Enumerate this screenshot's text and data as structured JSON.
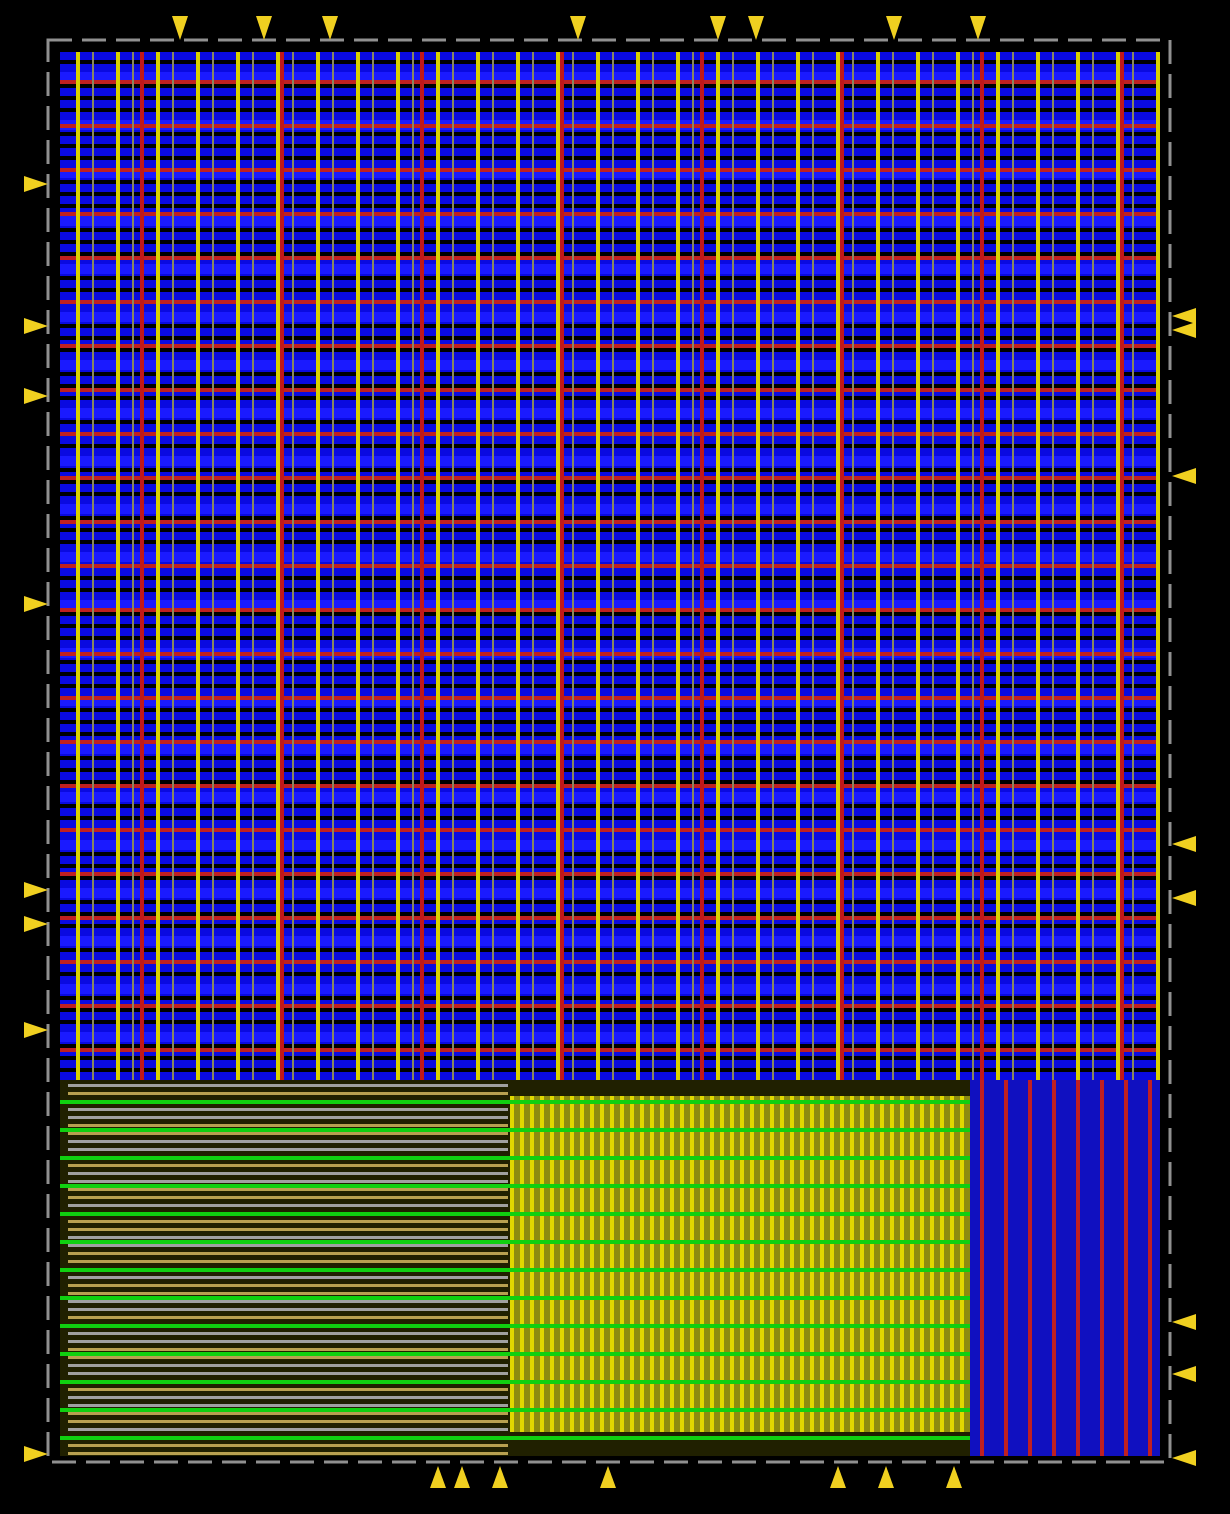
{
  "layout_view": {
    "kind": "chip-layout"
  }
}
